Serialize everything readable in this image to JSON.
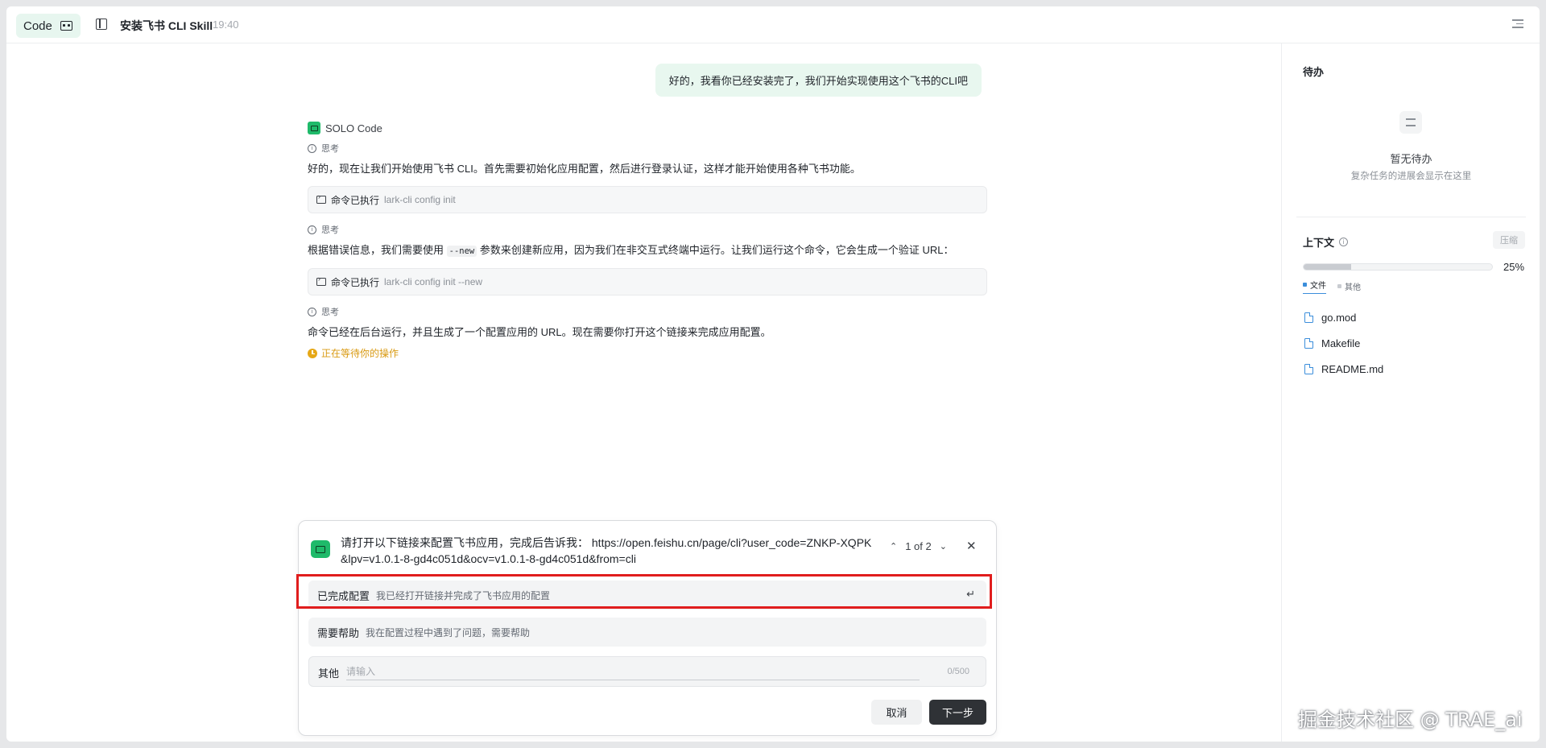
{
  "header": {
    "mode_label": "Code",
    "session_title": "安装飞书 CLI Skill",
    "session_time": "19:40",
    "icons": [
      "solo-icon",
      "sidebar-toggle-icon",
      "menu-icon"
    ]
  },
  "chat": {
    "user_message": "好的，我看你已经安装完了，我们开始实现使用这个飞书的CLI吧",
    "agent_name": "SOLO Code",
    "think_label": "思考",
    "steps": [
      {
        "think": "思考",
        "text_before": "好的，现在让我们开始使用飞书 CLI。首先需要初始化应用配置，然后进行登录认证，这样才能开始使用各种飞书功能。",
        "cmd_label": "命令已执行",
        "cmd": "lark-cli config init"
      },
      {
        "think": "思考",
        "text_a": "根据错误信息，我们需要使用 ",
        "code": "--new",
        "text_b": " 参数来创建新应用，因为我们在非交互式终端中运行。让我们运行这个命令，它会生成一个验证 URL：",
        "cmd_label": "命令已执行",
        "cmd": "lark-cli config init --new"
      },
      {
        "think": "思考",
        "text": "命令已经在后台运行，并且生成了一个配置应用的 URL。现在需要你打开这个链接来完成应用配置。"
      }
    ],
    "waiting": "正在等待你的操作"
  },
  "question": {
    "text": "请打开以下链接来配置飞书应用，完成后告诉我： https://open.feishu.cn/page/cli?user_code=ZNKP-XQPK&lpv=v1.0.1-8-gd4c051d&ocv=v1.0.1-8-gd4c051d&from=cli",
    "pager": "1 of 2",
    "options": [
      {
        "label": "已完成配置",
        "desc": "我已经打开链接并完成了飞书应用的配置",
        "selected": true
      },
      {
        "label": "需要帮助",
        "desc": "我在配置过程中遇到了问题，需要帮助",
        "selected": false
      }
    ],
    "other_label": "其他",
    "other_placeholder": "请输入",
    "other_counter": "0/500",
    "cancel": "取消",
    "next": "下一步",
    "enter_glyph": "↵"
  },
  "sidebar": {
    "todo_title": "待办",
    "todo_empty": "暂无待办",
    "todo_sub": "复杂任务的进展会显示在这里",
    "context_title": "上下文",
    "compress": "压缩",
    "context_percent": "25%",
    "context_fraction": 0.25,
    "legend": [
      {
        "label": "文件",
        "color": "#3b8edb"
      },
      {
        "label": "其他",
        "color": "#c9ccd1"
      }
    ],
    "files": [
      "go.mod",
      "Makefile",
      "README.md"
    ]
  },
  "watermark": "掘金技术社区 @ TRAE_ai",
  "colors": {
    "accent_green": "#1fba6a",
    "bubble_bg": "#e8f7ef",
    "waiting": "#d99a12",
    "highlight": "#e01d1d",
    "primary_button": "#2f3236"
  }
}
